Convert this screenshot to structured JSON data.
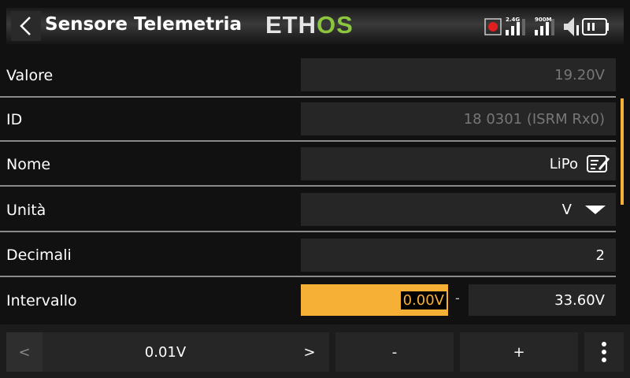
{
  "header": {
    "title": "Sensore Telemetria",
    "logo": "ETHOS",
    "status": {
      "rf1": "2.4G",
      "rf2": "900M"
    }
  },
  "rows": [
    {
      "label": "Valore",
      "value": "19.20V"
    },
    {
      "label": "ID",
      "value": "18 0301 (ISRM Rx0)"
    },
    {
      "label": "Nome",
      "value": "LiPo"
    },
    {
      "label": "Unità",
      "value": "V"
    },
    {
      "label": "Decimali",
      "value": "2"
    },
    {
      "label": "Intervallo",
      "min": "0.00V",
      "separator": "-",
      "max": "33.60V"
    }
  ],
  "bottom": {
    "prev": "<",
    "step": "0.01V",
    "next": ">",
    "minus": "-",
    "plus": "+"
  },
  "colors": {
    "accent": "#f7b036",
    "logo_green": "#8cc63f"
  }
}
